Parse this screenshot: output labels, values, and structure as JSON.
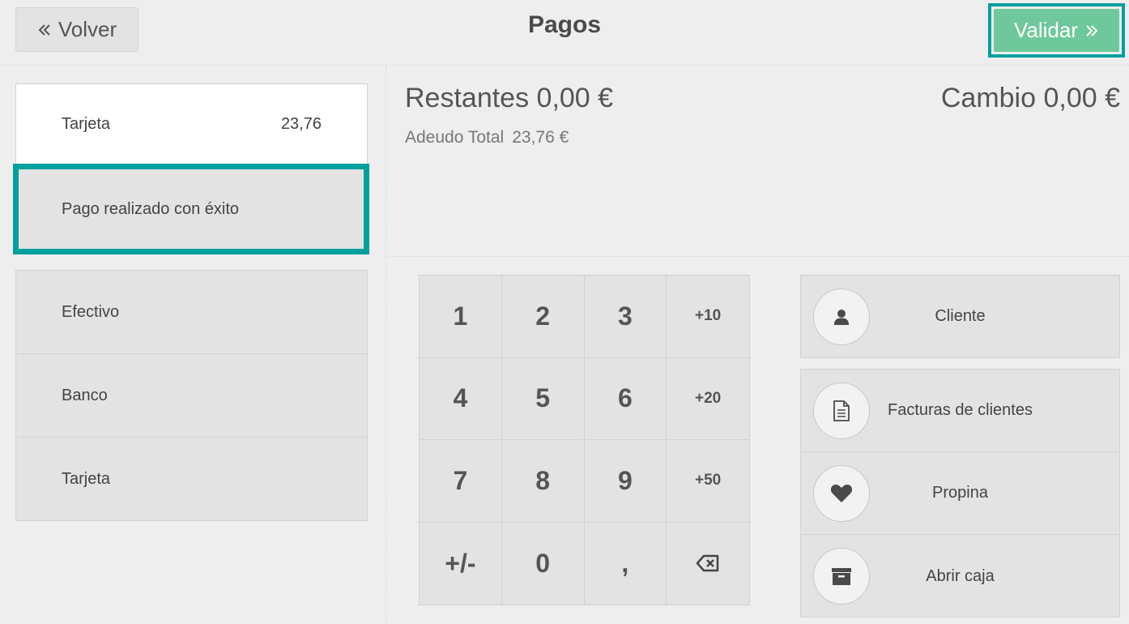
{
  "header": {
    "back_label": "Volver",
    "title": "Pagos",
    "validate_label": "Validar"
  },
  "paymentlines": [
    {
      "method": "Tarjeta",
      "amount": "23,76"
    }
  ],
  "payment_status": "Pago realizado con éxito",
  "payment_methods": [
    "Efectivo",
    "Banco",
    "Tarjeta"
  ],
  "summary": {
    "remaining": "Restantes 0,00 €",
    "change": "Cambio 0,00 €",
    "total_due_label": "Adeudo Total",
    "total_due_value": "23,76 €"
  },
  "numpad": [
    "1",
    "2",
    "3",
    "+10",
    "4",
    "5",
    "6",
    "+20",
    "7",
    "8",
    "9",
    "+50",
    "+/-",
    "0",
    ",",
    "backspace-icon"
  ],
  "actions": {
    "customer": "Cliente",
    "invoice": "Facturas de clientes",
    "tip": "Propina",
    "open_cashbox": "Abrir caja"
  },
  "colors": {
    "accent": "#00a09d",
    "validate_bg": "#6ec89b",
    "background": "#efeeee"
  }
}
